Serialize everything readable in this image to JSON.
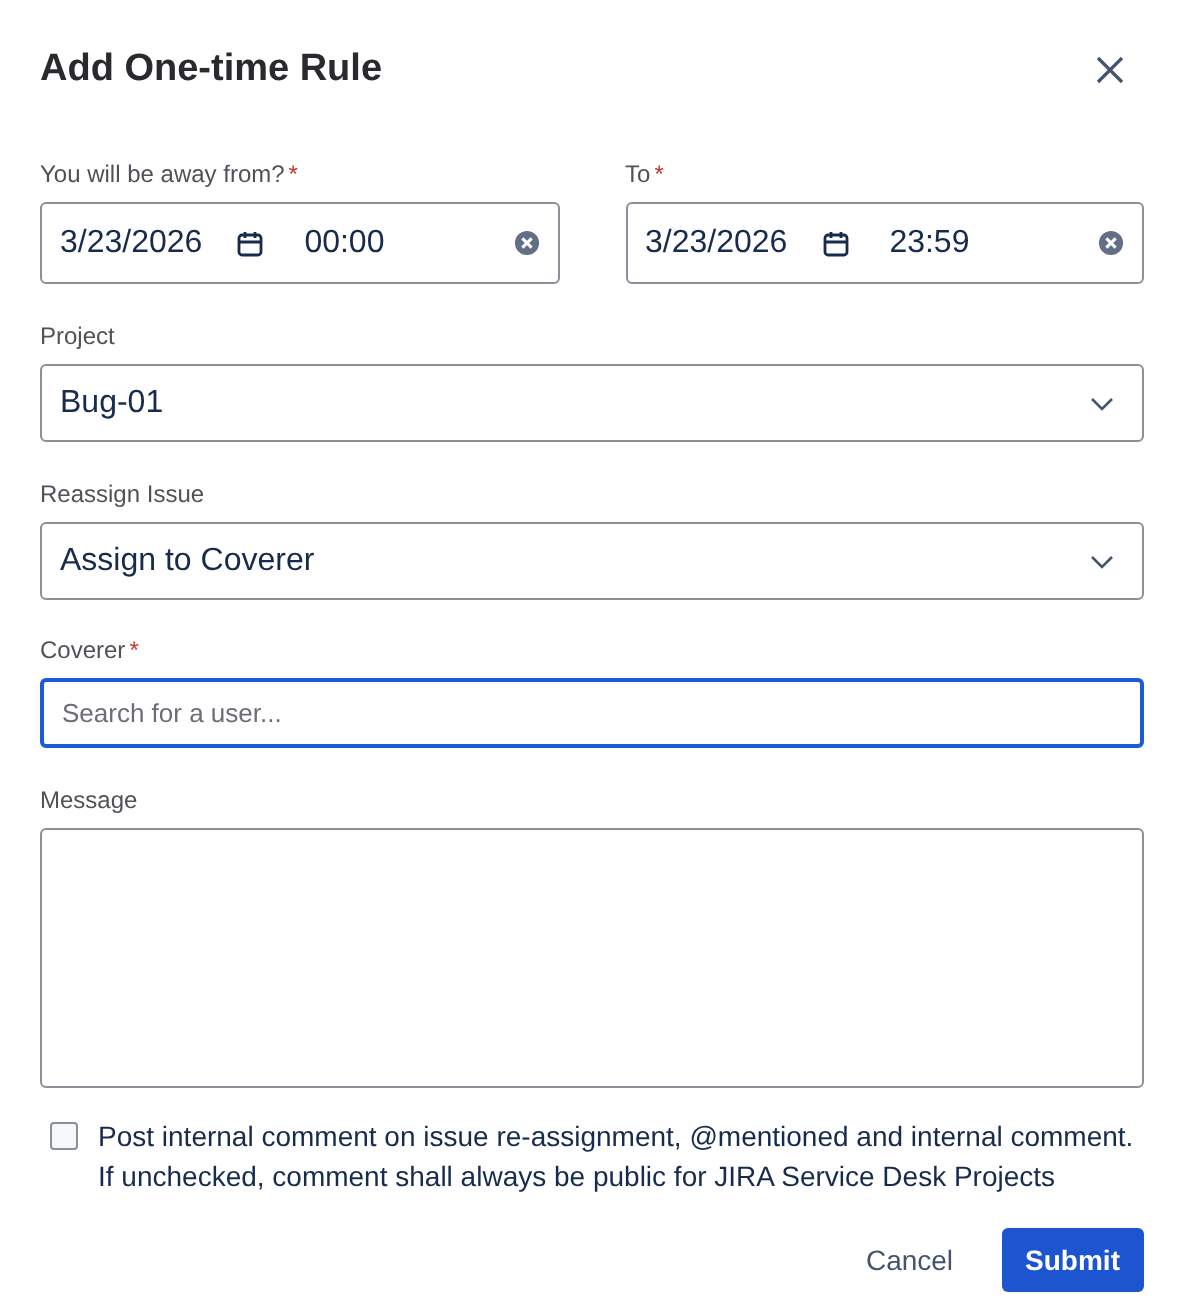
{
  "dialog": {
    "title": "Add One-time Rule"
  },
  "date_range": [
    {
      "label": "You will be away from?",
      "required_mark": "*",
      "date": "3/23/2026",
      "time": "00:00"
    },
    {
      "label": "To",
      "required_mark": "*",
      "date": "3/23/2026",
      "time": "23:59"
    }
  ],
  "fields": [
    {
      "kind": "select",
      "label": "Project",
      "value": "Bug-01",
      "focused": false
    },
    {
      "kind": "select",
      "label": "Reassign Issue",
      "value": "Assign to Coverer",
      "focused": false
    },
    {
      "kind": "search",
      "label": "Coverer",
      "required_mark": "*",
      "placeholder": "Search for a user...",
      "focused": true
    },
    {
      "kind": "textarea",
      "label": "Message",
      "focused": false
    }
  ],
  "checkbox": {
    "label": "Post internal comment on issue re-assignment, @mentioned and internal comment. If unchecked, comment shall always be public for JIRA Service Desk Projects",
    "checked": false
  },
  "buttons": [
    {
      "kind": "subtle",
      "label": "Cancel"
    },
    {
      "kind": "primary",
      "label": "Submit"
    }
  ]
}
